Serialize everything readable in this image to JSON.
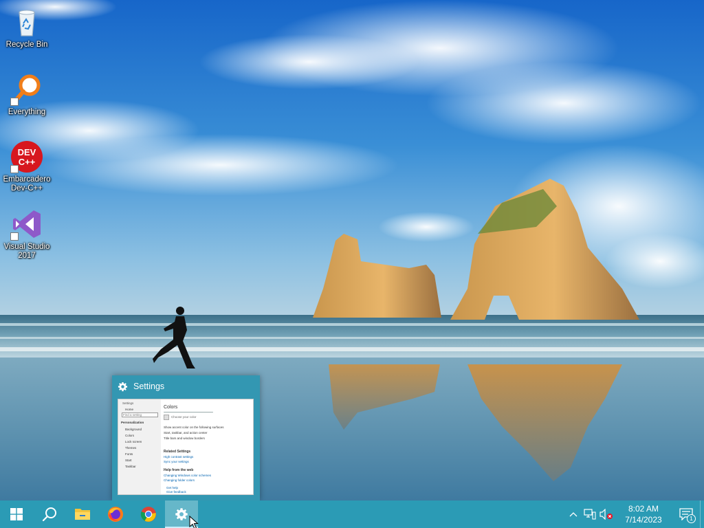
{
  "desktop": {
    "icons": [
      {
        "name": "recycle-bin",
        "label": "Recycle Bin",
        "icon": "recycle-bin-icon"
      },
      {
        "name": "everything",
        "label": "Everything",
        "icon": "magnifier-icon"
      },
      {
        "name": "devcpp",
        "label": "Embarcadero\nDev-C++",
        "icon": "devcpp-icon",
        "logo_text": [
          "DEV",
          "C++"
        ]
      },
      {
        "name": "visual-studio",
        "label": "Visual Studio\n2017",
        "icon": "visual-studio-icon"
      }
    ]
  },
  "preview": {
    "title": "Settings",
    "thumbnail": {
      "window_title": "Settings",
      "home": "Home",
      "search_placeholder": "Find a setting",
      "section": "Personalization",
      "nav": [
        "Background",
        "Colors",
        "Lock screen",
        "Themes",
        "Fonts",
        "Start",
        "Taskbar"
      ],
      "heading": "Colors",
      "choose_color": "Choose your color",
      "transparency": "Transparency effects",
      "options": [
        "Show accent color on the following surfaces",
        "Start, taskbar, and action center",
        "Title bars and window borders"
      ],
      "related_heading": "Related Settings",
      "related_links": [
        "High contrast settings",
        "Sync your settings"
      ],
      "help_heading": "Help from the web",
      "help_links": [
        "Changing Windows color schemes",
        "Changing folder colors"
      ],
      "footer_links": [
        "Get help",
        "Give feedback"
      ]
    }
  },
  "taskbar": {
    "buttons": [
      {
        "name": "start-button",
        "icon": "windows-logo-icon"
      },
      {
        "name": "search-button",
        "icon": "search-icon"
      },
      {
        "name": "file-explorer-button",
        "icon": "folder-icon"
      },
      {
        "name": "firefox-button",
        "icon": "firefox-icon"
      },
      {
        "name": "chrome-button",
        "icon": "chrome-icon"
      },
      {
        "name": "settings-button",
        "icon": "gear-icon",
        "active": true
      }
    ],
    "tray": {
      "icons": [
        "chevron-up-icon",
        "network-icon",
        "volume-muted-icon"
      ],
      "time": "8:02 AM",
      "date": "7/14/2023",
      "notification_count": "1"
    }
  },
  "colors": {
    "taskbar": "#2b9bb5",
    "preview": "#3397b2"
  }
}
